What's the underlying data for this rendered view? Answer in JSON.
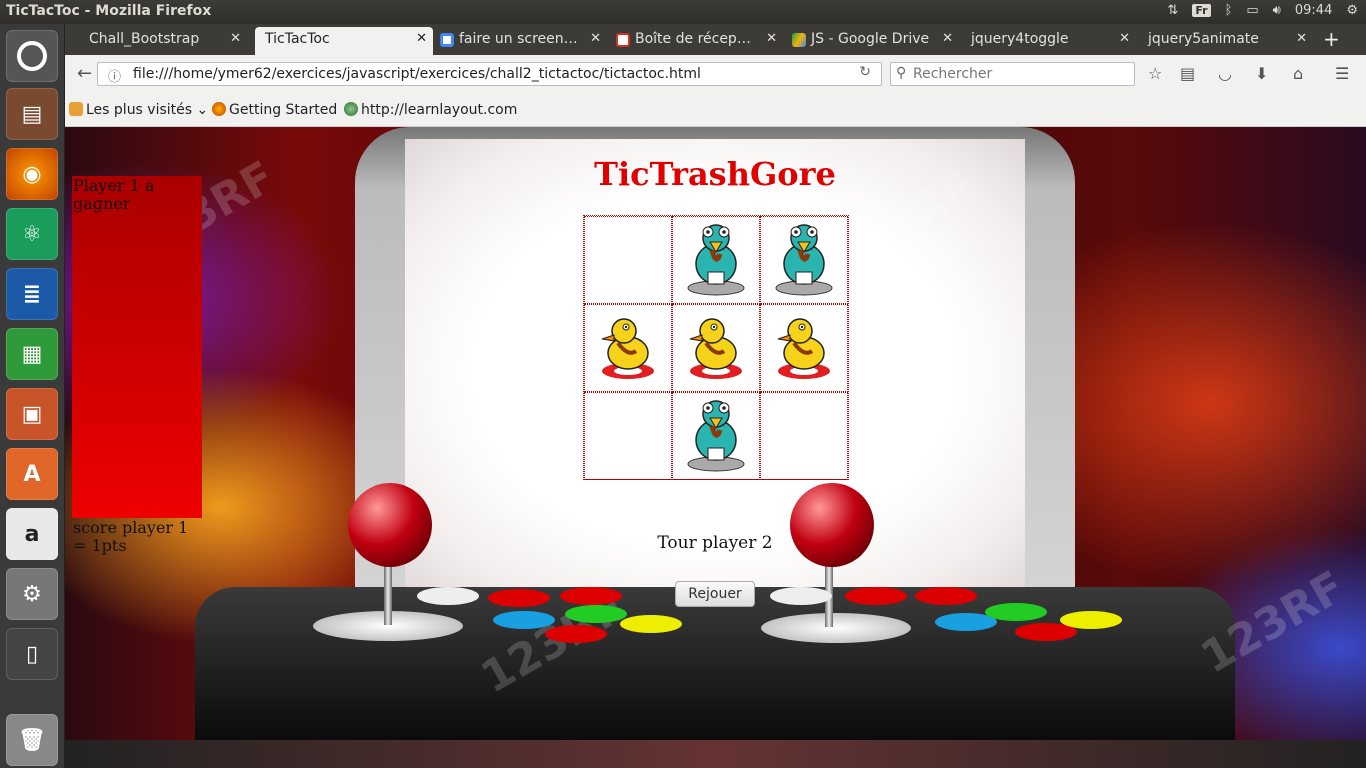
{
  "os": {
    "window_title": "TicTacToc - Mozilla Firefox",
    "keyboard_layout": "Fr",
    "clock": "09:44"
  },
  "browser": {
    "tabs": [
      {
        "label": "Chall_Bootstrap",
        "active": false,
        "icon": "page-icon"
      },
      {
        "label": "TicTacToc",
        "active": true,
        "icon": "page-icon"
      },
      {
        "label": "faire un screen…",
        "active": false,
        "icon": "google-icon"
      },
      {
        "label": "Boîte de récep…",
        "active": false,
        "icon": "gmail-icon"
      },
      {
        "label": "JS - Google Drive",
        "active": false,
        "icon": "drive-icon"
      },
      {
        "label": "jquery4toggle",
        "active": false,
        "icon": "page-icon"
      },
      {
        "label": "jquery5animate",
        "active": false,
        "icon": "page-icon"
      }
    ],
    "tab_close": "✕",
    "new_tab": "+",
    "url": "file:///home/ymer62/exercices/javascript/exercices/chall2_tictactoc/tictactoc.html",
    "search_placeholder": "Rechercher",
    "bookmarks": [
      "Les plus visités",
      "Getting Started",
      "http://learnlayout.com"
    ]
  },
  "game": {
    "title": "TicTrashGore",
    "winner_message": "Player 1 a gagner",
    "score_text": "score player 1 = 1pts",
    "turn_text": "Tour player 2",
    "replay_label": "Rejouer",
    "board": [
      "",
      "O",
      "O",
      "X",
      "X",
      "X",
      "",
      "O",
      ""
    ],
    "player1_piece": "yellow-duck-icon",
    "player2_piece": "teal-bird-icon",
    "watermark": "123RF"
  },
  "colors": {
    "title_red": "#e00000",
    "score_panel": "#d80000",
    "board_border": "#b00000"
  }
}
